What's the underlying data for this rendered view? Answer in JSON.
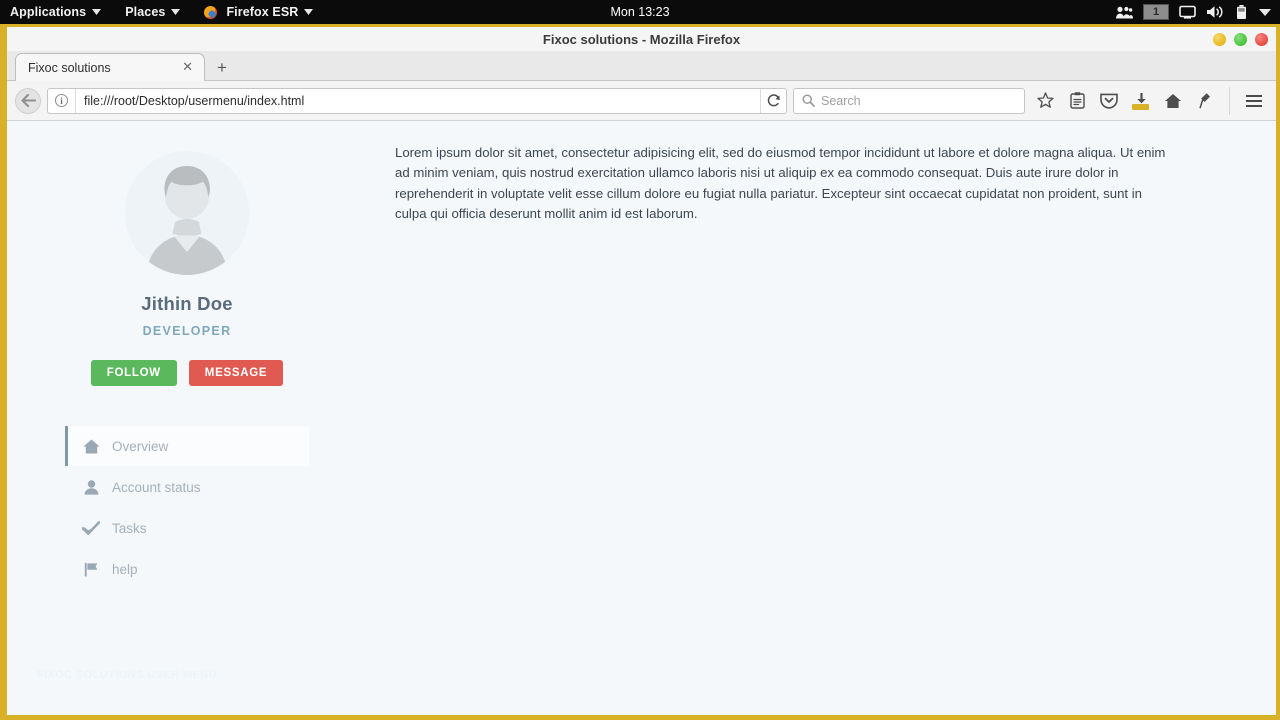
{
  "desktop": {
    "menus": [
      {
        "label": "Applications",
        "icon": "none"
      },
      {
        "label": "Places",
        "icon": "none"
      },
      {
        "label": "Firefox ESR",
        "icon": "firefox-logo"
      }
    ],
    "clock": "Mon 13:23",
    "tray": {
      "users_icon": "users-icon",
      "workspace": "1",
      "display_icon": "display-icon",
      "volume_icon": "volume-icon",
      "battery_icon": "battery-icon",
      "menu_icon": "chevron-down-icon"
    }
  },
  "window": {
    "title": "Fixoc solutions - Mozilla Firefox",
    "controls": {
      "minimize_color": "#e5b81f",
      "maximize_color": "#45c33a",
      "close_color": "#e7483f"
    },
    "frame_color": "#d9b128"
  },
  "browser": {
    "tabs": [
      {
        "title": "Fixoc solutions",
        "close_label": "✕",
        "active": true
      }
    ],
    "new_tab_label": "+",
    "back_label": "←",
    "identity_label": "i",
    "url": "file:///root/Desktop/usermenu/index.html",
    "reload_label": "⟳",
    "search": {
      "placeholder": "Search",
      "icon": "search-icon"
    },
    "toolbar_icons": [
      "bookmark-star-icon",
      "reader-list-icon",
      "pocket-icon",
      "downloads-icon",
      "home-icon",
      "sync-pin-icon"
    ],
    "menu_icon": "hamburger-icon"
  },
  "profile": {
    "avatar_icon": "user-avatar-placeholder",
    "name": "Jithin Doe",
    "role": "DEVELOPER",
    "follow_label": "FOLLOW",
    "message_label": "MESSAGE",
    "follow_color": "#5cb85c",
    "message_color": "#e05a52",
    "name_color": "#5a6b7b",
    "role_color": "#7fa8bd"
  },
  "menu": {
    "items": [
      {
        "label": "Overview",
        "icon": "home-icon",
        "active": true
      },
      {
        "label": "Account status",
        "icon": "user-icon",
        "active": false
      },
      {
        "label": "Tasks",
        "icon": "check-icon",
        "active": false
      },
      {
        "label": "help",
        "icon": "flag-icon",
        "active": false
      }
    ],
    "active_accent": "#7d9aa3"
  },
  "content": {
    "bio": "Lorem ipsum dolor sit amet, consectetur adipisicing elit, sed do eiusmod tempor incididunt ut labore et dolore magna aliqua. Ut enim ad minim veniam, quis nostrud exercitation ullamco laboris nisi ut aliquip ex ea commodo consequat. Duis aute irure dolor in reprehenderit in voluptate velit esse cillum dolore eu fugiat nulla pariatur. Excepteur sint occaecat cupidatat non proident, sunt in culpa qui officia deserunt mollit anim id est laborum."
  },
  "watermark": {
    "text": "FIXOC SOLUTIONS USER MENU"
  },
  "page": {
    "background": "#f4f8fb"
  }
}
